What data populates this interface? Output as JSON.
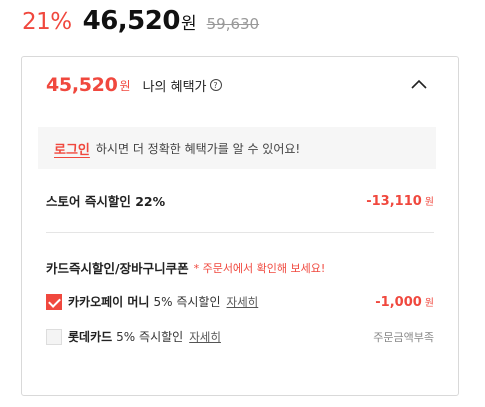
{
  "price": {
    "discount_rate": "21%",
    "sale_price": "46,520",
    "currency_unit": "원",
    "original_price": "59,630"
  },
  "benefit": {
    "price": "45,520",
    "currency_unit": "원",
    "label": "나의 혜택가",
    "help_icon": "?"
  },
  "login_notice": {
    "link_label": "로그인",
    "message": "하시면 더 정확한 혜택가를 알 수 있어요!"
  },
  "store_discount": {
    "label": "스토어 즉시할인 22%",
    "amount": "-13,110",
    "unit": "원"
  },
  "card_section": {
    "title": "카드즉시할인/장바구니쿠폰",
    "note": "* 주문서에서 확인해 보세요!",
    "options": [
      {
        "name": "카카오페이 머니",
        "rate": "5% 즉시할인",
        "detail": "자세히",
        "checked": true,
        "amount": "-1,000",
        "unit": "원"
      },
      {
        "name": "롯데카드",
        "rate": "5% 즉시할인",
        "detail": "자세히",
        "checked": false,
        "status": "주문금액부족"
      }
    ]
  },
  "colors": {
    "accent": "#f0483e",
    "border": "#d9d9d9",
    "notice_bg": "#f6f6f6"
  }
}
